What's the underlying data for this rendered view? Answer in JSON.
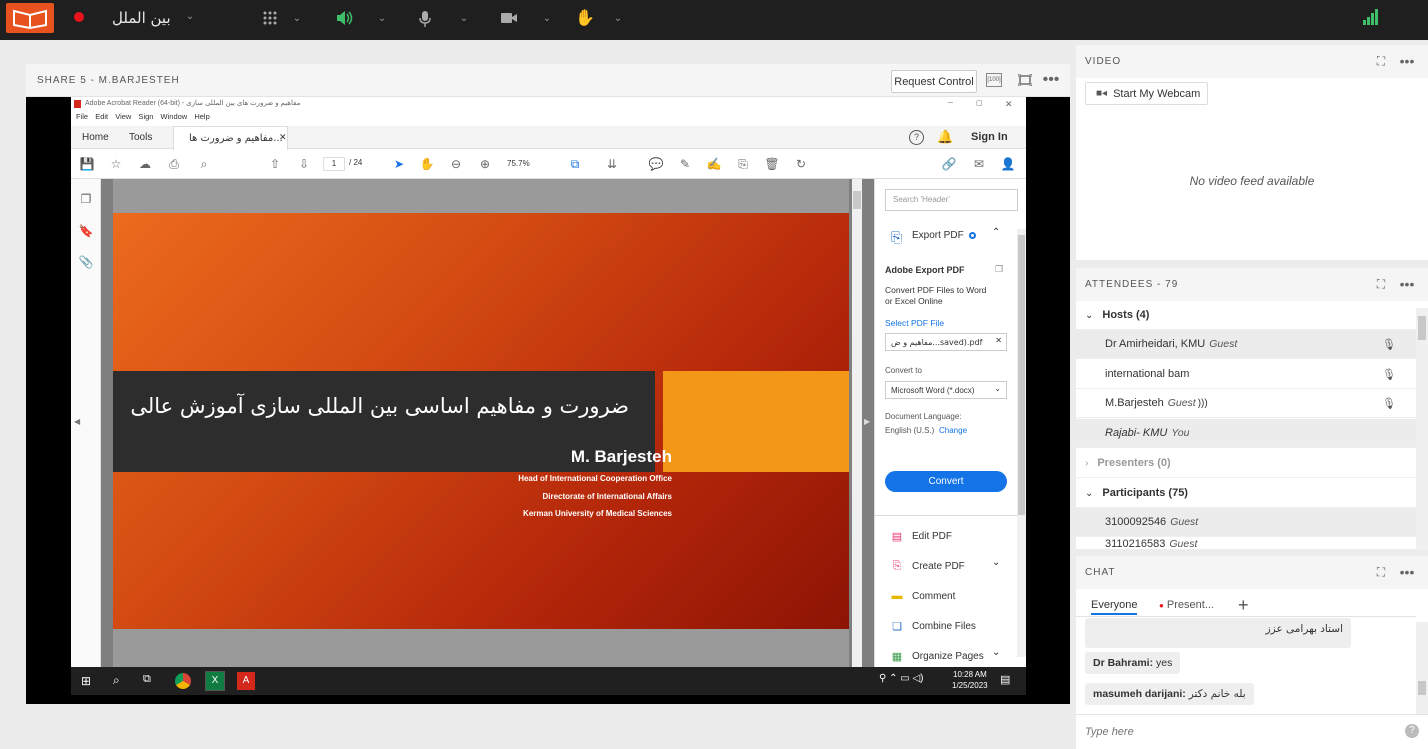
{
  "topbar": {
    "meeting_name": "بین الملل"
  },
  "share": {
    "title": "SHARE 5  - M.BARJESTEH",
    "request_control": "Request Control",
    "fullscreen_label": "[100]"
  },
  "acrobat": {
    "window_title": "مفاهیم و ضرورت های بین المللی سازی - Adobe Acrobat Reader (64-bit)",
    "menu": [
      "File",
      "Edit",
      "View",
      "Sign",
      "Window",
      "Help"
    ],
    "tabs": {
      "home": "Home",
      "tools": "Tools",
      "doc": "مفاهیم و ضرورت ها..."
    },
    "sign_in": "Sign In",
    "page_current": "1",
    "page_total": "/ 24",
    "zoom": "75.7%",
    "slide": {
      "title": "ضرورت و مفاهیم اساسی بین المللی سازی آموزش عالی",
      "name": "M. Barjesteh",
      "lines": [
        "Head of International Cooperation Office",
        "Directorate of International Affairs",
        "Kerman University of Medical Sciences"
      ]
    },
    "right_pane": {
      "search_placeholder": "Search 'Header'",
      "export_pdf": "Export PDF",
      "adobe_export": "Adobe Export PDF",
      "convert_desc_1": "Convert PDF Files to Word",
      "convert_desc_2": "or Excel Online",
      "select_file": "Select PDF File",
      "file_name": "مفاهیم و ض...saved).pdf",
      "convert_to": "Convert to",
      "format": "Microsoft Word (*.docx)",
      "doc_language": "Document Language:",
      "language": "English (U.S.)",
      "change": "Change",
      "convert_button": "Convert",
      "tools": [
        "Edit PDF",
        "Create PDF",
        "Comment",
        "Combine Files",
        "Organize Pages"
      ]
    },
    "taskbar": {
      "time": "10:28 AM",
      "date": "1/25/2023"
    }
  },
  "video": {
    "title": "VIDEO",
    "start_webcam": "Start My Webcam",
    "no_feed": "No video feed available"
  },
  "attendees": {
    "title": "ATTENDEES  - 79",
    "hosts_label": "Hosts (4)",
    "hosts": [
      {
        "name": "Dr Amirheidari, KMU",
        "role": "Guest"
      },
      {
        "name": "international bam",
        "role": ""
      },
      {
        "name": "M.Barjesteh",
        "role": "Guest"
      },
      {
        "name": "Rajabi- KMU",
        "role": "You"
      }
    ],
    "presenters_label": "Presenters (0)",
    "participants_label": "Participants (75)",
    "participants": [
      {
        "name": "3100092546",
        "role": "Guest"
      },
      {
        "name": "3110216583",
        "role": "Guest"
      }
    ]
  },
  "chat": {
    "title": "CHAT",
    "tabs": [
      "Everyone",
      "Present..."
    ],
    "messages": [
      {
        "sender": "",
        "text": "استاد بهرامی عزز"
      },
      {
        "sender": "Dr Bahrami:",
        "text": "yes"
      },
      {
        "sender": "masumeh darijani:",
        "text": "بله خانم دکتر"
      }
    ],
    "input_placeholder": "Type here"
  },
  "colors": {
    "accent": "#e8521e",
    "record": "#e8131b",
    "acrobat_blue": "#1473e6",
    "slide_orange": "#f29718"
  }
}
